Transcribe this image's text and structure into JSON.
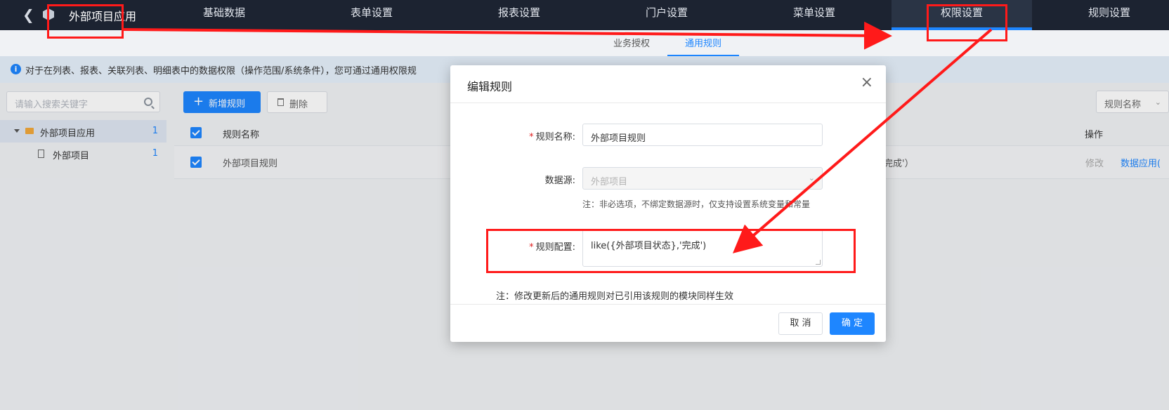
{
  "topbar": {
    "app_title": "外部项目应用",
    "nav": [
      "基础数据",
      "表单设置",
      "报表设置",
      "门户设置",
      "菜单设置",
      "权限设置",
      "规则设置"
    ]
  },
  "subnav": {
    "tabs": [
      "业务授权",
      "通用规则"
    ]
  },
  "banner": {
    "text": "对于在列表、报表、关联列表、明细表中的数据权限（操作范围/系统条件），您可通过通用权限规"
  },
  "leftpanel": {
    "search_placeholder": "请输入搜索关键字",
    "tree": [
      {
        "label": "外部项目应用",
        "count": "1"
      },
      {
        "label": "外部项目",
        "count": "1"
      }
    ]
  },
  "toolbar": {
    "add_label": "新增规则",
    "delete_label": "删除",
    "filter_label": "规则名称"
  },
  "table": {
    "headers": {
      "name": "规则名称",
      "ops": "操作"
    },
    "row": {
      "name": "外部项目规则",
      "config_tail": "完成'）",
      "op_edit": "修改",
      "op_apply": "数据应用("
    }
  },
  "modal": {
    "title": "编辑规则",
    "close": "×",
    "name_label": "规则名称:",
    "name_value": "外部项目规则",
    "datasource_label": "数据源:",
    "datasource_value": "外部项目",
    "datasource_hint": "注：非必选项，不绑定数据源时，仅支持设置系统变量和常量",
    "config_label": "规则配置:",
    "config_value": "like({外部项目状态},'完成')",
    "note": "注：修改更新后的通用规则对已引用该规则的模块同样生效",
    "cancel_label": "取 消",
    "ok_label": "确 定"
  },
  "colors": {
    "accent": "#1e86ff",
    "topbar": "#1c2331",
    "annotation": "#ff1a1a"
  }
}
